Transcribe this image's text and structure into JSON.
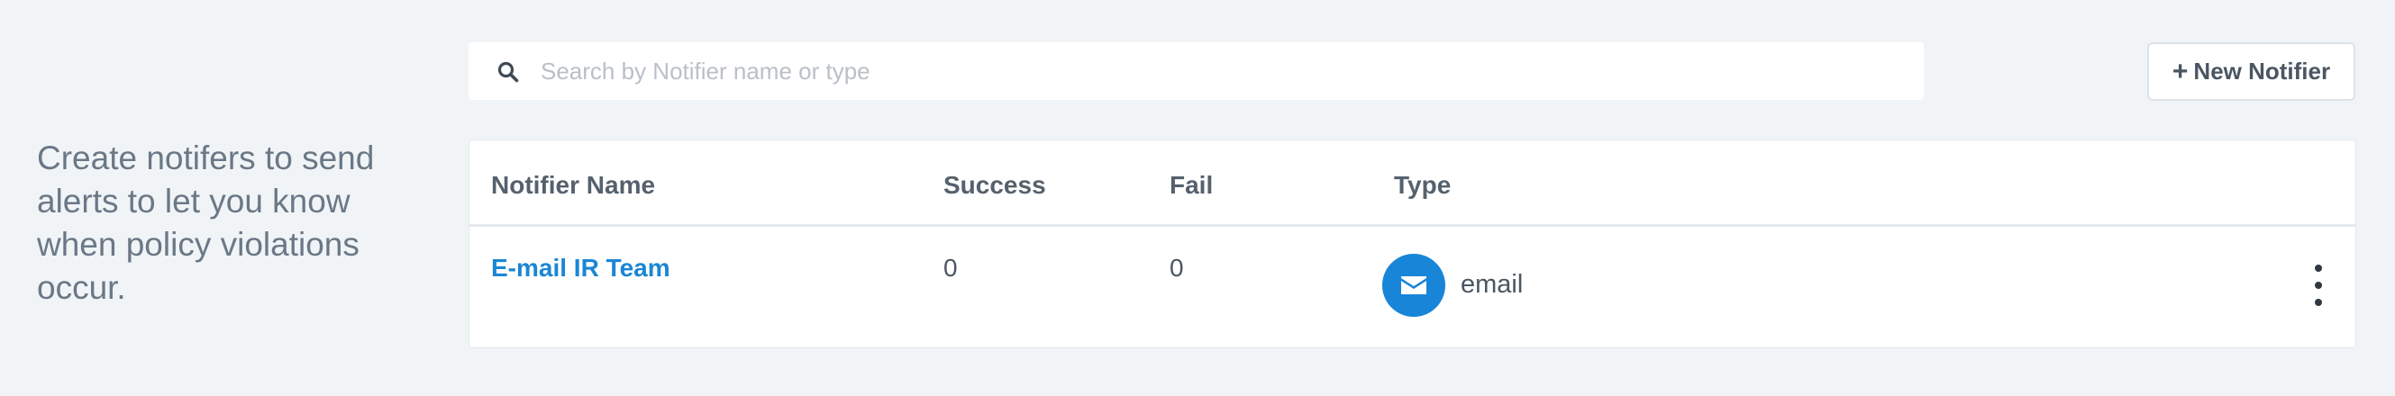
{
  "intro": {
    "text": "Create notifers to send alerts to let you know when policy violations occur."
  },
  "search": {
    "placeholder": "Search by Notifier name or type",
    "icon": "search-icon"
  },
  "new_button": {
    "label": "New Notifier",
    "icon": "plus-icon"
  },
  "table": {
    "columns": [
      "Notifier Name",
      "Success",
      "Fail",
      "Type"
    ],
    "rows": [
      {
        "name": "E-mail IR Team",
        "success": "0",
        "fail": "0",
        "type": "email",
        "type_icon": "envelope-icon"
      }
    ]
  },
  "colors": {
    "accent": "#1b86d4",
    "background": "#f1f4f7"
  }
}
